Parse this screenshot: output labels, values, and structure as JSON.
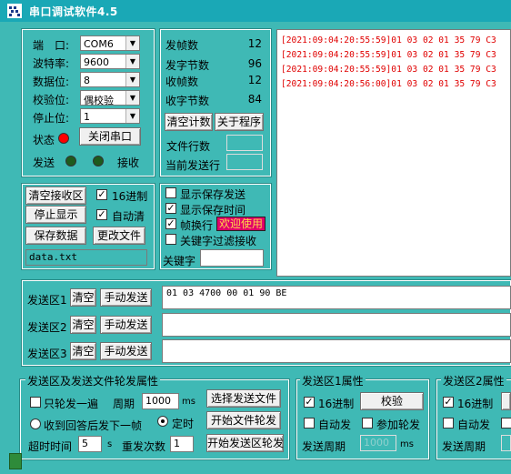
{
  "window": {
    "title": "串口调试软件4.5"
  },
  "serial": {
    "port_label": "端　口:",
    "port_value": "COM6",
    "baud_label": "波特率:",
    "baud_value": "9600",
    "databits_label": "数据位:",
    "databits_value": "8",
    "parity_label": "校验位:",
    "parity_value": "偶校验",
    "stopbits_label": "停止位:",
    "stopbits_value": "1",
    "status_label": "状态",
    "close_port_label": "关闭串口",
    "send_label": "发送",
    "recv_label": "接收",
    "status_led_color": "#ff0000",
    "send_led_color": "#1d5b1d",
    "recv_led_color": "#1d5b1d"
  },
  "counters": {
    "send_frames_label": "发帧数",
    "send_frames": "12",
    "send_bytes_label": "发字节数",
    "send_bytes": "96",
    "recv_frames_label": "收帧数",
    "recv_frames": "12",
    "recv_bytes_label": "收字节数",
    "recv_bytes": "84",
    "clear_count_label": "清空计数",
    "about_label": "关于程序",
    "file_lines_label": "文件行数",
    "current_line_label": "当前发送行"
  },
  "receive_log": [
    "[2021:09:04:20:55:59]01 03 02 01 35 79 C3",
    "[2021:09:04:20:55:59]01 03 02 01 35 79 C3",
    "[2021:09:04:20:55:59]01 03 02 01 35 79 C3",
    "[2021:09:04:20:56:00]01 03 02 01 35 79 C3"
  ],
  "recv_controls": {
    "clear_recv_label": "清空接收区",
    "hex_label": "16进制",
    "stop_display_label": "停止显示",
    "auto_clear_label": "自动清",
    "save_data_label": "保存数据",
    "change_file_label": "更改文件",
    "filename": "data.txt"
  },
  "display_options": {
    "show_save_send_label": "显示保存发送",
    "show_save_time_label": "显示保存时间",
    "frame_newline_label": "帧换行",
    "welcome_label": "欢迎使用",
    "keyword_filter_label": "关键字过滤接收",
    "keyword_label": "关键字"
  },
  "send_areas": [
    {
      "label": "发送区1",
      "clear": "清空",
      "manual": "手动发送",
      "content": "01 03 4700 00 01  90 BE"
    },
    {
      "label": "发送区2",
      "clear": "清空",
      "manual": "手动发送",
      "content": ""
    },
    {
      "label": "发送区3",
      "clear": "清空",
      "manual": "手动发送",
      "content": ""
    }
  ],
  "rotation": {
    "group_title": "发送区及发送文件轮发属性",
    "only_once_label": "只轮发一遍",
    "period_label": "周期",
    "period_value": "1000",
    "period_unit": "ms",
    "select_file_label": "选择发送文件",
    "after_reply_label": "收到回答后发下一帧",
    "timed_label": "定时",
    "start_file_label": "开始文件轮发",
    "timeout_label": "超时时间",
    "timeout_value": "5",
    "timeout_unit": "s",
    "retry_label": "重发次数",
    "retry_value": "1",
    "start_area_label": "开始发送区轮发"
  },
  "area1_props": {
    "group_title": "发送区1属性",
    "hex_label": "16进制",
    "verify_label": "校验",
    "auto_send_label": "自动发",
    "join_rotation_label": "参加轮发",
    "period_label": "发送周期",
    "period_value": "1000",
    "period_unit": "ms"
  },
  "area2_props": {
    "group_title": "发送区2属性",
    "hex_label": "16进制",
    "auto_send_label": "自动发",
    "period_label": "发送周期"
  }
}
